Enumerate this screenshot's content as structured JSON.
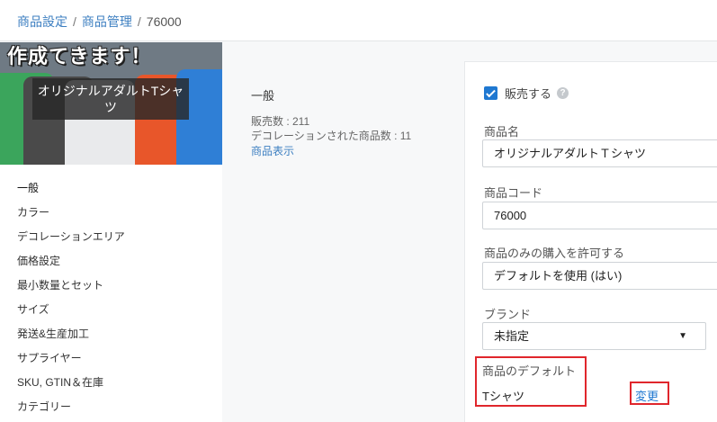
{
  "breadcrumb": {
    "items": [
      "商品設定",
      "商品管理"
    ],
    "current": "76000",
    "separator": "/"
  },
  "banner": {
    "heading": "作成てきます！",
    "label": "オリジナルアダルトTシャツ",
    "shirt_colors": [
      "#3ba55c",
      "#4a4a4a",
      "#e9eaec",
      "#e8562a",
      "#2f7fd6",
      "#8b8f94"
    ]
  },
  "side_nav": [
    "一般",
    "カラー",
    "デコレーションエリア",
    "価格設定",
    "最小数量とセット",
    "サイズ",
    "発送&生産加工",
    "サプライヤー",
    "SKU, GTIN＆在庫",
    "カテゴリー"
  ],
  "info": {
    "title": "一般",
    "sold_count": "販売数 : 211",
    "decorated_count": "デコレーションされた商品数 : 11",
    "view_link": "商品表示"
  },
  "form": {
    "sell_label": "販売する",
    "sell_checked": true,
    "help_icon": "?",
    "name_label": "商品名",
    "name_value": "オリジナルアダルトＴシャツ",
    "code_label": "商品コード",
    "code_value": "76000",
    "purchase_label": "商品のみの購入を許可する",
    "purchase_value": "デフォルトを使用 (はい)",
    "brand_label": "ブランド",
    "brand_value": "未指定",
    "brand_caret": "▼",
    "default_label": "商品のデフォルト",
    "default_value": "Tシャツ",
    "change_link": "変更"
  },
  "colors": {
    "link": "#3d7fc1",
    "accent": "#1f78d1",
    "highlight": "#e0262c"
  }
}
